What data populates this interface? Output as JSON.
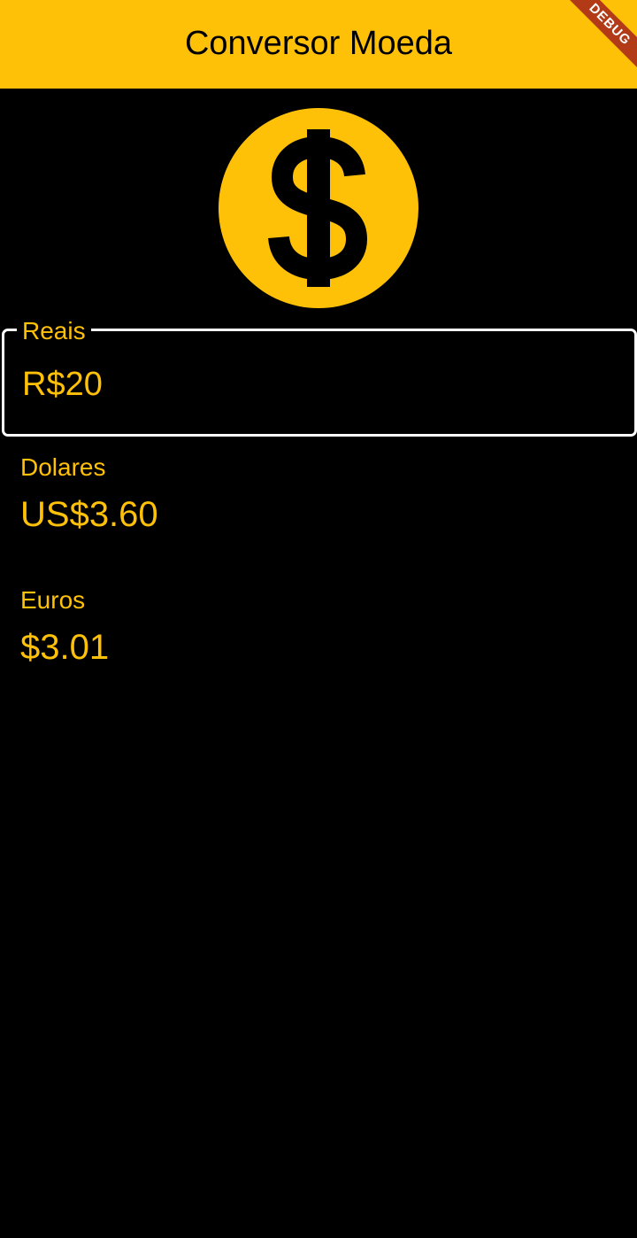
{
  "app_bar": {
    "title": "Conversor Moeda",
    "debug_banner": "DEBUG",
    "background_color": "#FFC107"
  },
  "hero_icon": {
    "name": "dollar-coin-icon",
    "color": "#FFC107"
  },
  "fields": {
    "reais": {
      "label": "Reais",
      "value": "R$20"
    },
    "dolares": {
      "label": "Dolares",
      "value": "US$3.60"
    },
    "euros": {
      "label": "Euros",
      "value": "$3.01"
    }
  },
  "colors": {
    "accent": "#FFC107",
    "background": "#000000",
    "input_border": "#FFFFFF"
  }
}
